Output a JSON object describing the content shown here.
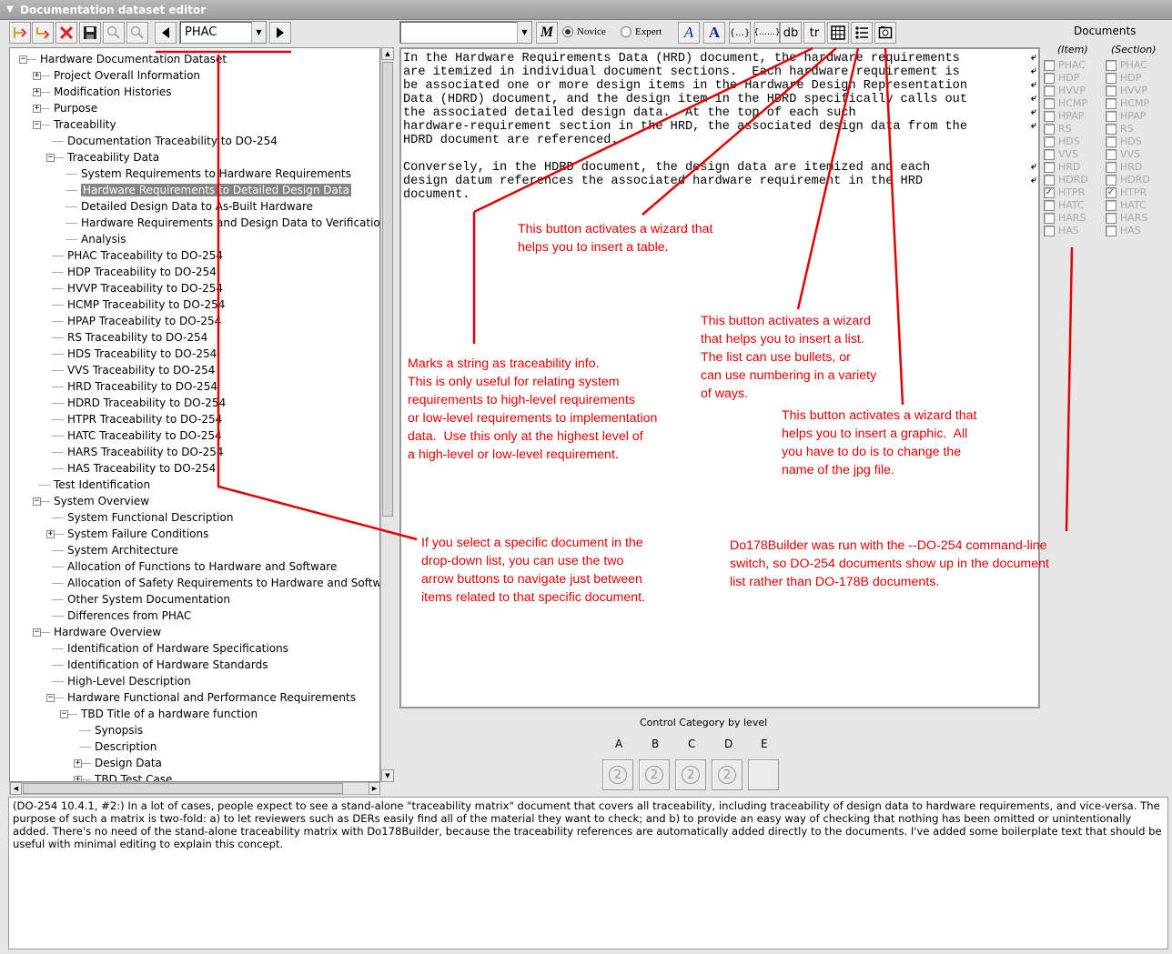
{
  "window": {
    "title": "Documentation dataset editor"
  },
  "toolbar_left": {
    "doc_select_value": "PHAC"
  },
  "toolbar_right": {
    "style_select_value": "",
    "novice_label": "Novice",
    "expert_label": "Expert",
    "selected_mode": "Novice",
    "buttons": {
      "mono_bold": "M",
      "italic_a": "A",
      "bold_a": "A",
      "braces": "{…}",
      "braces_wide": "{……}",
      "db": "db",
      "tr": "tr"
    }
  },
  "tree": {
    "items": [
      {
        "label": "Hardware Documentation Dataset"
      },
      {
        "label": "Project Overall Information"
      },
      {
        "label": "Modification Histories"
      },
      {
        "label": "Purpose"
      },
      {
        "label": "Traceability"
      },
      {
        "label": "Documentation Traceability to DO-254"
      },
      {
        "label": "Traceability Data"
      },
      {
        "label": "System Requirements to Hardware Requirements"
      },
      {
        "label": "Hardware Requirements to Detailed Design Data"
      },
      {
        "label": "Detailed Design Data to As-Built Hardware"
      },
      {
        "label": "Hardware Requirements and Design Data to Verification Ca"
      },
      {
        "label": "Analysis"
      },
      {
        "label": "PHAC Traceability to DO-254"
      },
      {
        "label": "HDP Traceability to DO-254"
      },
      {
        "label": "HVVP Traceability to DO-254"
      },
      {
        "label": "HCMP Traceability to DO-254"
      },
      {
        "label": "HPAP Traceability to DO-254"
      },
      {
        "label": "RS Traceability to DO-254"
      },
      {
        "label": "HDS Traceability to DO-254"
      },
      {
        "label": "VVS Traceability to DO-254"
      },
      {
        "label": "HRD Traceability to DO-254"
      },
      {
        "label": "HDRD Traceability to DO-254"
      },
      {
        "label": "HTPR Traceability to DO-254"
      },
      {
        "label": "HATC Traceability to DO-254"
      },
      {
        "label": "HARS Traceability to DO-254"
      },
      {
        "label": "HAS Traceability to DO-254"
      },
      {
        "label": "Test Identification"
      },
      {
        "label": "System Overview"
      },
      {
        "label": "System Functional Description"
      },
      {
        "label": "System Failure Conditions"
      },
      {
        "label": "System Architecture"
      },
      {
        "label": "Allocation of Functions to Hardware and Software"
      },
      {
        "label": "Allocation of Safety Requirements to Hardware and Software"
      },
      {
        "label": "Other System Documentation"
      },
      {
        "label": "Differences from PHAC"
      },
      {
        "label": "Hardware Overview"
      },
      {
        "label": "Identification of Hardware Specifications"
      },
      {
        "label": "Identification of Hardware Standards"
      },
      {
        "label": "High-Level Description"
      },
      {
        "label": "Hardware Functional and Performance Requirements"
      },
      {
        "label": "TBD Title of a hardware function"
      },
      {
        "label": "Synopsis"
      },
      {
        "label": "Description"
      },
      {
        "label": "Design Data"
      },
      {
        "label": "TBD Test Case"
      }
    ]
  },
  "editor": {
    "lines": [
      "In the Hardware Requirements Data (HRD) document, the hardware requirements",
      "are itemized in individual document sections.  Each hardware requirement is",
      "be associated one or more design items in the Hardware Design Representation",
      "Data (HDRD) document, and the design item in the HDRD specifically calls out",
      "the associated detailed design data.  At the top of each such",
      "hardware-requirement section in the HRD, the associated design data from the",
      "HDRD document are referenced.",
      "",
      "Conversely, in the HDRD document, the design data are itemized and each",
      "design datum references the associated hardware requirement in the HRD",
      "document."
    ],
    "mark_glyph": "⤶"
  },
  "documents": {
    "title": "Documents",
    "item_header": "(Item)",
    "section_header": "(Section)",
    "list": [
      {
        "name": "PHAC",
        "item": false,
        "section": false
      },
      {
        "name": "HDP",
        "item": false,
        "section": false
      },
      {
        "name": "HVVP",
        "item": false,
        "section": false
      },
      {
        "name": "HCMP",
        "item": false,
        "section": false
      },
      {
        "name": "HPAP",
        "item": false,
        "section": false
      },
      {
        "name": "RS",
        "item": false,
        "section": false
      },
      {
        "name": "HDS",
        "item": false,
        "section": false
      },
      {
        "name": "VVS",
        "item": false,
        "section": false
      },
      {
        "name": "HRD",
        "item": false,
        "section": false
      },
      {
        "name": "HDRD",
        "item": false,
        "section": false
      },
      {
        "name": "HTPR",
        "item": true,
        "section": true
      },
      {
        "name": "HATC",
        "item": false,
        "section": false
      },
      {
        "name": "HARS",
        "item": false,
        "section": false
      },
      {
        "name": "HAS",
        "item": false,
        "section": false
      }
    ]
  },
  "control_category": {
    "title": "Control Category by level",
    "levels": [
      "A",
      "B",
      "C",
      "D",
      "E"
    ],
    "button_glyph": "2"
  },
  "bottom_text": "(DO-254 10.4.1, #2:)  In a lot of cases, people expect to see a stand-alone \"traceability matrix\" document that covers all traceability, including traceability of design data to hardware requirements, and vice-versa.  The purpose of such a matrix is two-fold:  a) to let reviewers such as DERs easily find all of the material they want to check; and b) to provide an easy way of checking that nothing has been omitted or unintentionally added.  There's no need of the stand-alone traceability matrix with Do178Builder, because the traceability references are automatically added directly to the documents.  I've added some boilerplate text that should be useful with minimal editing to explain this concept.",
  "annotations": {
    "table_wizard": "This button activates a wizard that\nhelps you to insert a table.",
    "list_wizard": "This button activates a wizard\nthat helps you to insert a list.\nThe list can use bullets, or\ncan use numbering in a variety\nof ways.",
    "traceability_mark": "Marks a string as traceability info.\nThis is only useful for relating system\nrequirements to high-level requirements\nor low-level requirements to implementation\ndata.  Use this only at the highest level of\na high-level or low-level requirement.",
    "graphic_wizard": "This button activates a wizard that\nhelps you to insert a graphic.  All\nyou have to do is to change the\nname of the jpg file.",
    "arrow_nav": "If you select a specific document in the\ndrop-down list, you can use the two\narrow buttons to navigate just between\nitems related to that specific document.",
    "do254_switch": "Do178Builder was run with the --DO-254 command-line\nswitch, so DO-254 documents show up in the document\nlist rather than DO-178B documents."
  },
  "colors": {
    "annotation_red": "#e30000",
    "selection_gray": "#858585"
  }
}
